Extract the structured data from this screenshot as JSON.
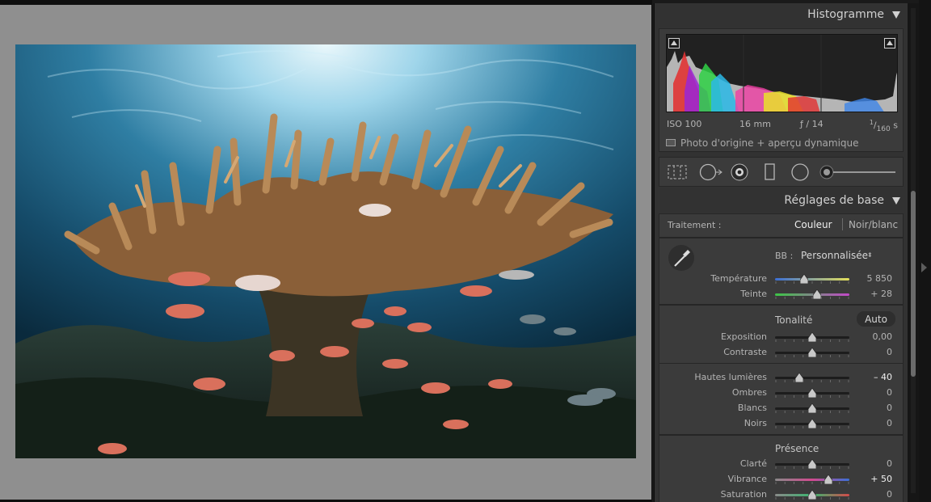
{
  "photo": {
    "subject": "underwater-reef",
    "colors": {
      "water_deep": "#0b2f45",
      "water_mid": "#1e6587",
      "surface": "#b9e4f3",
      "coral": "#9a6b3f",
      "fish": "#d86a57"
    }
  },
  "histogram": {
    "title": "Histogramme",
    "iso": "ISO 100",
    "focal": "16 mm",
    "aperture": "ƒ / 14",
    "shutter_num": "1",
    "shutter_den": "160",
    "shutter_unit": "s",
    "preview_label": "Photo d'origine + aperçu dynamique"
  },
  "tools": [
    "crop-overlay",
    "spot-removal",
    "red-eye",
    "graduated-filter",
    "radial-filter",
    "adjustment-brush"
  ],
  "basic": {
    "title": "Réglages de base",
    "treatment_label": "Traitement :",
    "treatment_color": "Couleur",
    "treatment_bw": "Noir/blanc",
    "wb_label": "BB :",
    "wb_value": "Personnalisée",
    "tonality": "Tonalité",
    "auto": "Auto",
    "presence": "Présence",
    "sliders": [
      {
        "key": "temperature",
        "label": "Température",
        "value": "5 850",
        "fraction": 0.39,
        "gradient": "temp"
      },
      {
        "key": "tint",
        "label": "Teinte",
        "value": "+ 28",
        "fraction": 0.57,
        "gradient": "tint"
      },
      {
        "key": "exposure",
        "label": "Exposition",
        "value": "0,00",
        "fraction": 0.5,
        "gradient": "none"
      },
      {
        "key": "contrast",
        "label": "Contraste",
        "value": "0",
        "fraction": 0.5,
        "gradient": "none"
      },
      {
        "key": "highlights",
        "label": "Hautes lumières",
        "value": "– 40",
        "fraction": 0.33,
        "gradient": "none",
        "hot": true
      },
      {
        "key": "shadows",
        "label": "Ombres",
        "value": "0",
        "fraction": 0.5,
        "gradient": "none"
      },
      {
        "key": "whites",
        "label": "Blancs",
        "value": "0",
        "fraction": 0.5,
        "gradient": "none"
      },
      {
        "key": "blacks",
        "label": "Noirs",
        "value": "0",
        "fraction": 0.5,
        "gradient": "none"
      },
      {
        "key": "clarity",
        "label": "Clarté",
        "value": "0",
        "fraction": 0.5,
        "gradient": "none"
      },
      {
        "key": "vibrance",
        "label": "Vibrance",
        "value": "+ 50",
        "fraction": 0.72,
        "gradient": "vib",
        "hot": true
      },
      {
        "key": "saturation",
        "label": "Saturation",
        "value": "0",
        "fraction": 0.5,
        "gradient": "sat"
      }
    ]
  }
}
